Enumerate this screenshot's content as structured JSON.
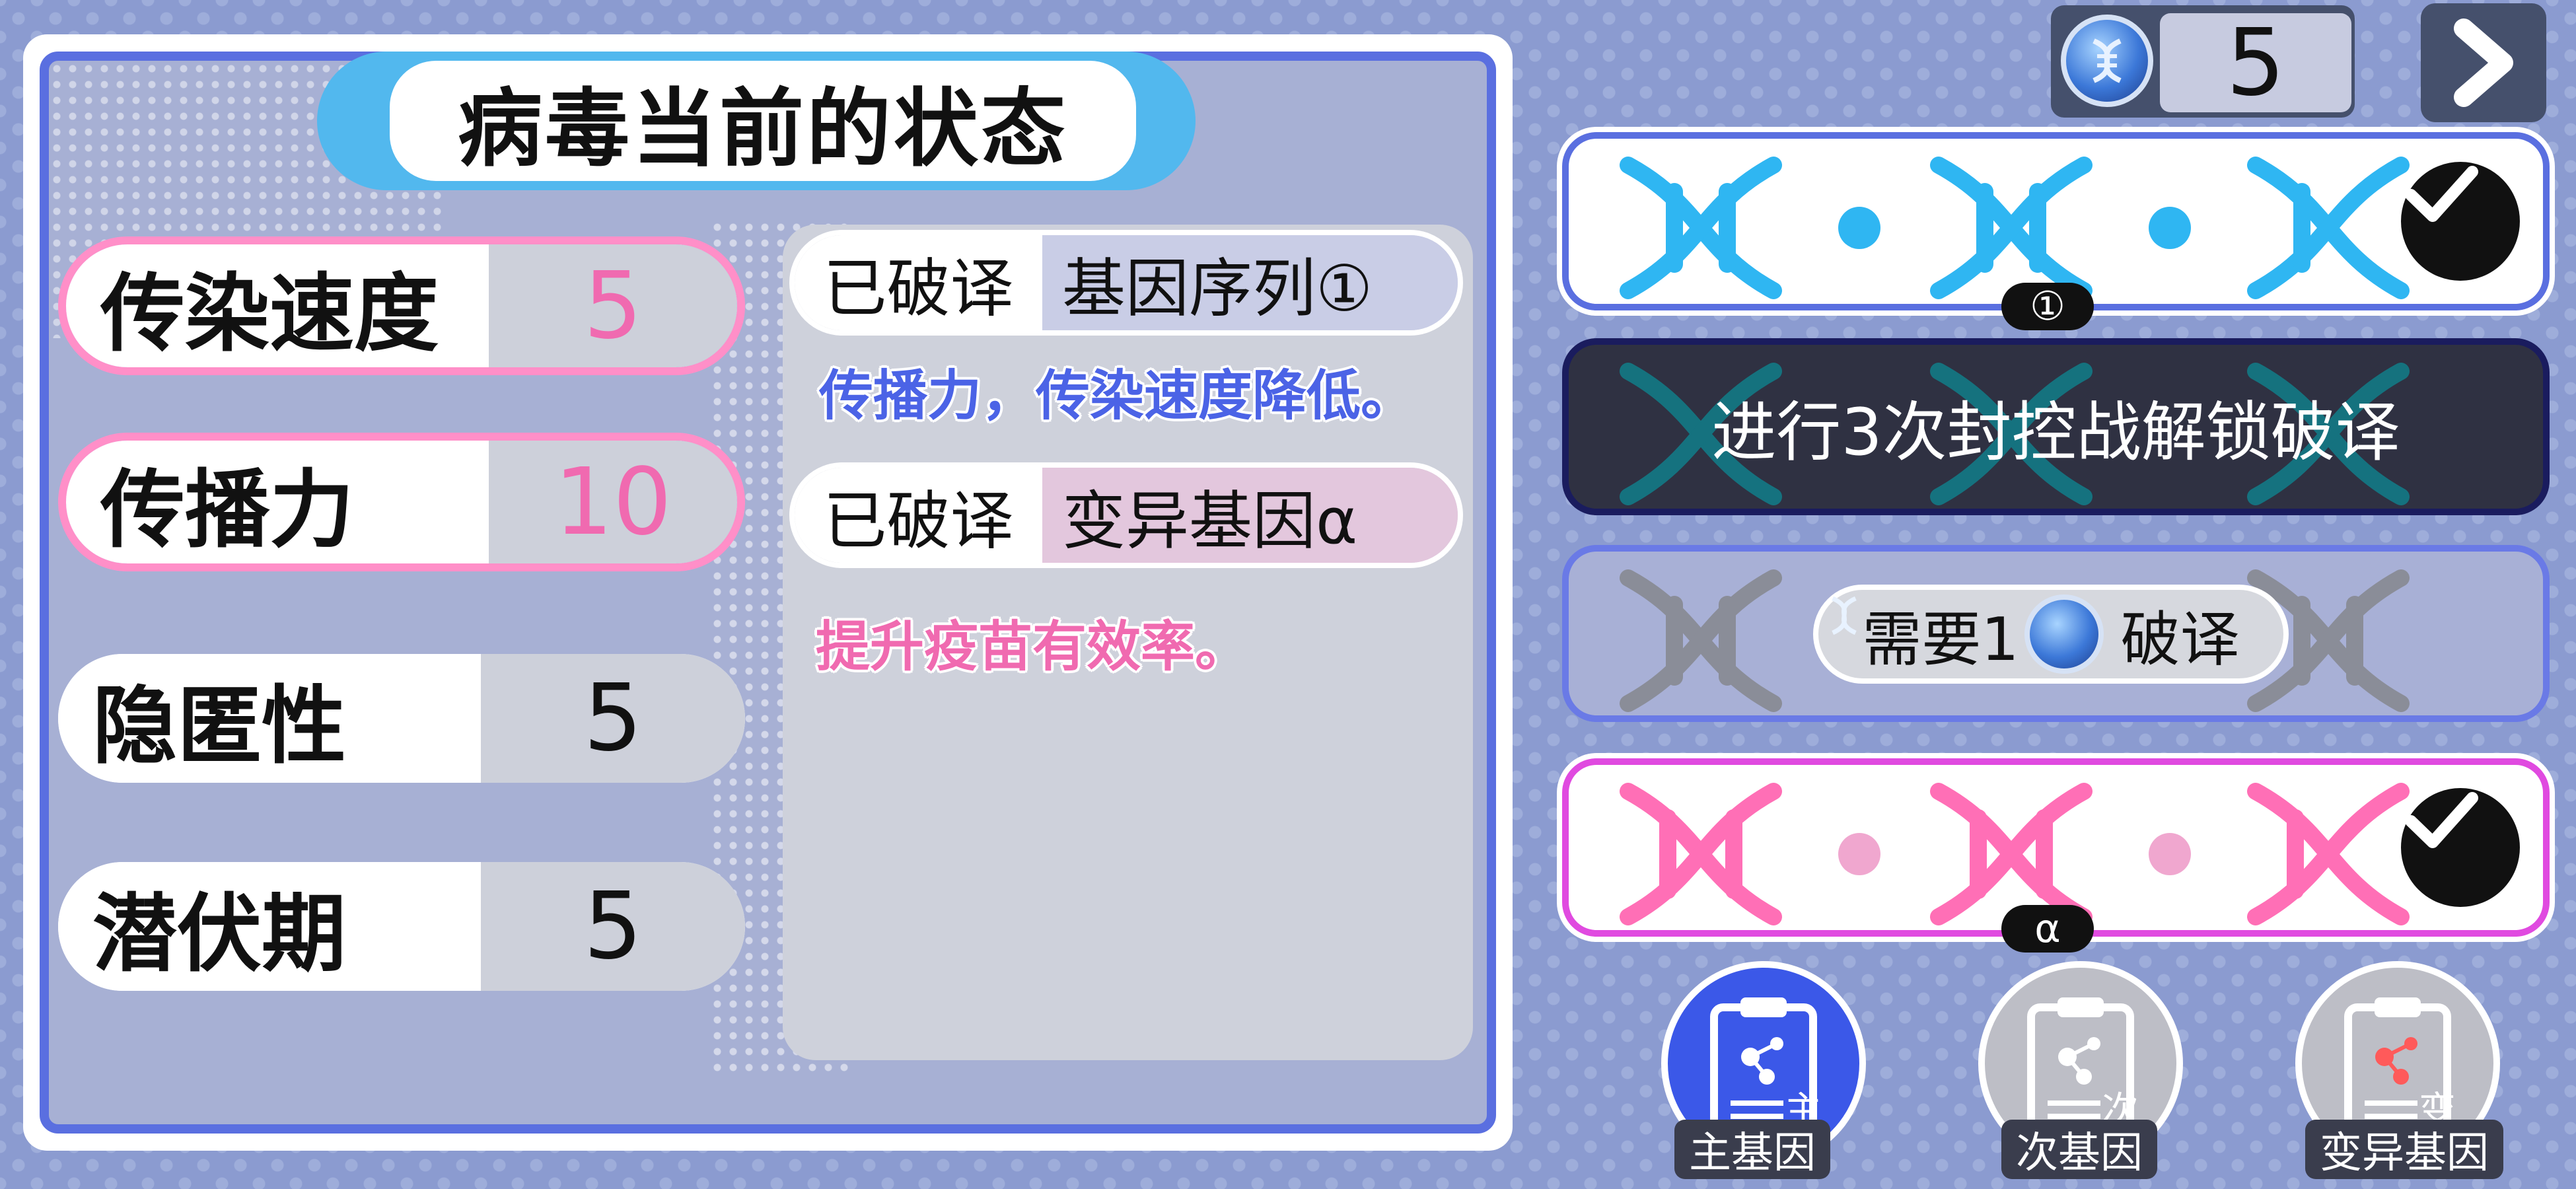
{
  "panel": {
    "title": "病毒当前的状态"
  },
  "stats": [
    {
      "label": "传染速度",
      "value": "5",
      "highlighted": true
    },
    {
      "label": "传播力",
      "value": "10",
      "highlighted": true
    },
    {
      "label": "隐匿性",
      "value": "5",
      "highlighted": false
    },
    {
      "label": "潜伏期",
      "value": "5",
      "highlighted": false
    }
  ],
  "genes": [
    {
      "status": "已破译",
      "name": "基因序列①",
      "description": "传播力，传染速度降低。",
      "desc_color": "#4b63e6",
      "name_bg": "#c9cde6"
    },
    {
      "status": "已破译",
      "name": "变异基因α",
      "description": "提升疫苗有效率。",
      "desc_color": "#f06ab0",
      "name_bg": "#e3c7dd"
    }
  ],
  "currency": {
    "amount": "5",
    "icon": "dna-coin-icon"
  },
  "next_icon": "chevron-right-icon",
  "cards": [
    {
      "type": "unlocked",
      "badge": "①",
      "color": "#2fb6f2",
      "checked": true
    },
    {
      "type": "locked",
      "text": "进行3次封控战解锁破译",
      "color": "#137a86"
    },
    {
      "type": "purchasable",
      "prefix": "需要1",
      "suffix": "破译",
      "color": "#8a8d98"
    },
    {
      "type": "unlocked",
      "badge": "α",
      "color": "#ff6fb6",
      "checked": true
    }
  ],
  "tabs": [
    {
      "label": "主基因",
      "mark": "主",
      "active": true
    },
    {
      "label": "次基因",
      "mark": "次",
      "active": false
    },
    {
      "label": "变异基因",
      "mark": "变",
      "active": false
    }
  ],
  "colors": {
    "accent_blue": "#5a6fe0",
    "accent_pink": "#ff8fc8",
    "title_blue": "#52b8ee",
    "background": "#8b9bd0"
  }
}
